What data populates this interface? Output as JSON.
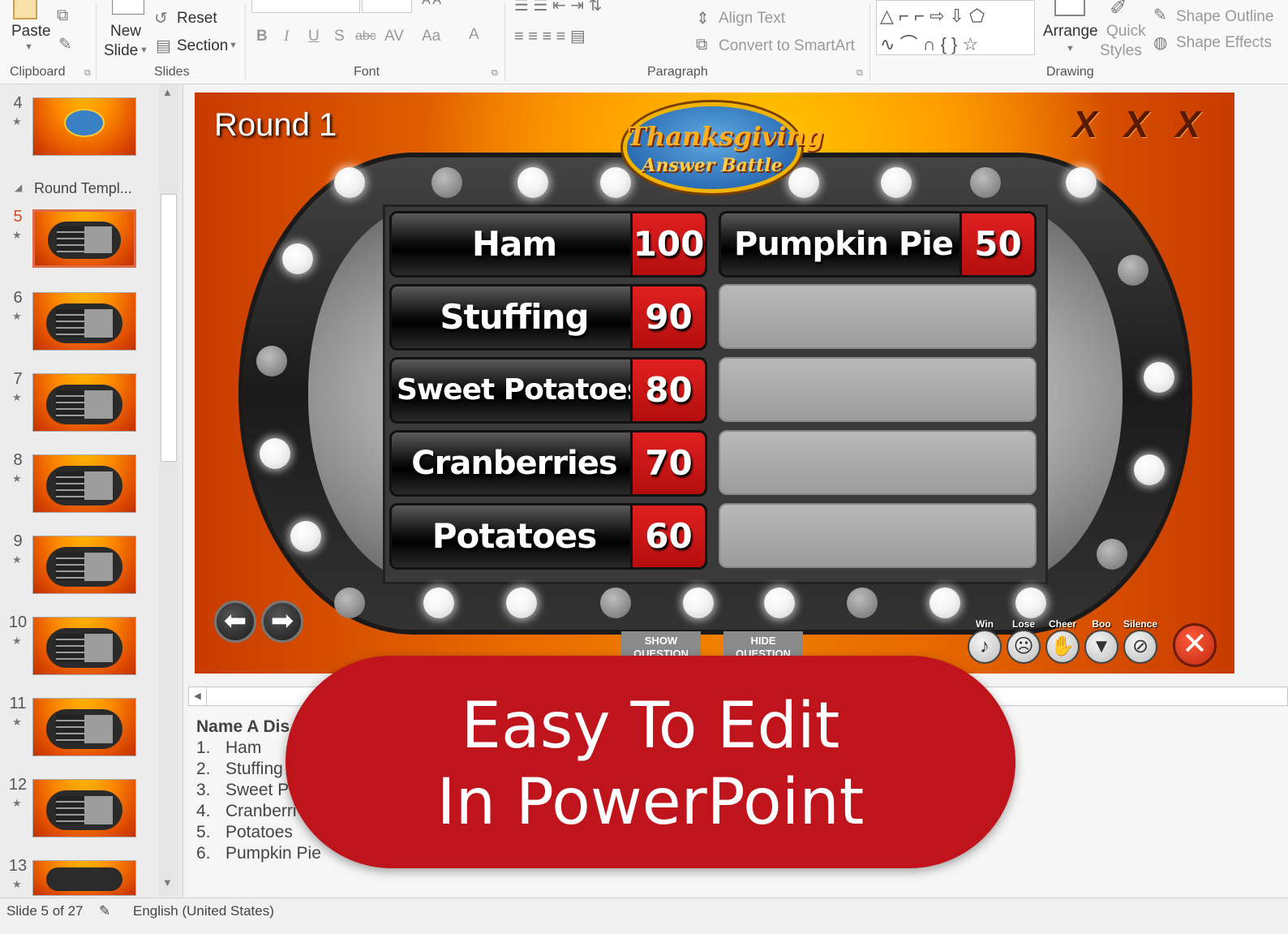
{
  "ribbon": {
    "clipboard": {
      "paste": "Paste",
      "group": "Clipboard"
    },
    "slides": {
      "new_slide": "New",
      "new_slide2": "Slide",
      "reset": "Reset",
      "section": "Section",
      "group": "Slides"
    },
    "font": {
      "group": "Font",
      "bold": "B",
      "italic": "I",
      "underline": "U",
      "shadow": "S",
      "strike": "abc",
      "spacing": "AV",
      "case": "Aa",
      "color": "A"
    },
    "paragraph": {
      "group": "Paragraph",
      "align_text": "Align Text",
      "convert_smartart": "Convert to SmartArt"
    },
    "drawing": {
      "group": "Drawing",
      "arrange": "Arrange",
      "quick": "Quick",
      "styles": "Styles",
      "shape_outline": "Shape Outline",
      "shape_effects": "Shape Effects"
    }
  },
  "thumbnails": {
    "section_label": "Round Templ...",
    "slides": [
      {
        "num": "4",
        "star": "★"
      },
      {
        "num": "5",
        "star": "★"
      },
      {
        "num": "6",
        "star": "★"
      },
      {
        "num": "7",
        "star": "★"
      },
      {
        "num": "8",
        "star": "★"
      },
      {
        "num": "9",
        "star": "★"
      },
      {
        "num": "10",
        "star": "★"
      },
      {
        "num": "11",
        "star": "★"
      },
      {
        "num": "12",
        "star": "★"
      },
      {
        "num": "13",
        "star": "★"
      }
    ]
  },
  "slide": {
    "round_title": "Round 1",
    "strikes": "X X X",
    "logo_line1": "Thanksgiving",
    "logo_line2": "Answer Battle",
    "answers": [
      {
        "text": "Ham",
        "points": "100"
      },
      {
        "text": "Stuffing",
        "points": "90"
      },
      {
        "text": "Sweet Potatoes",
        "points": "80"
      },
      {
        "text": "Cranberries",
        "points": "70"
      },
      {
        "text": "Potatoes",
        "points": "60"
      },
      {
        "text": "Pumpkin Pie",
        "points": "50"
      }
    ],
    "show_question": "SHOW QUESTION",
    "hide_question": "HIDE QUESTION",
    "sounds": [
      "Win",
      "Lose",
      "Cheer",
      "Boo",
      "Silence"
    ]
  },
  "notes": {
    "title": "Name A Dis",
    "items": [
      {
        "n": "1.",
        "text": "Ham"
      },
      {
        "n": "2.",
        "text": "Stuffing"
      },
      {
        "n": "3.",
        "text": "Sweet P"
      },
      {
        "n": "4.",
        "text": "Cranberri"
      },
      {
        "n": "5.",
        "text": "Potatoes"
      },
      {
        "n": "6.",
        "text": "Pumpkin Pie"
      }
    ]
  },
  "banner": {
    "line1": "Easy To Edit",
    "line2": "In PowerPoint"
  },
  "status": {
    "slide_count": "Slide 5 of 27",
    "language": "English (United States)"
  },
  "colors": {
    "accent_red": "#c0141c",
    "active_thumb": "#e06b4a",
    "points_red": "#c8141a"
  }
}
